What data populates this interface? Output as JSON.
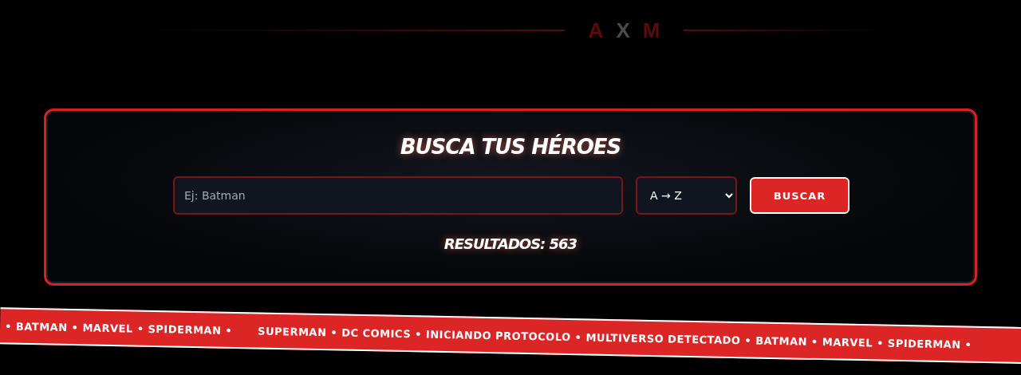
{
  "logo": {
    "letters": [
      {
        "text": "A",
        "color": "#5c0b0b"
      },
      {
        "text": "X",
        "color": "#4a4a4a"
      },
      {
        "text": "M",
        "color": "#5c0b0b"
      }
    ]
  },
  "search": {
    "title": "BUSCA TUS HÉROES",
    "placeholder": "Ej: Batman",
    "sort": "A → Z",
    "button": "BUSCAR",
    "results": "RESULTADOS: 563"
  },
  "ticker": [
    "• BATMAN • MARVEL • SPIDERMAN •",
    "SUPERMAN • DC COMICS • INICIANDO PROTOCOLO • MULTIVERSO DETECTADO • BATMAN • MARVEL • SPIDERMAN •"
  ]
}
